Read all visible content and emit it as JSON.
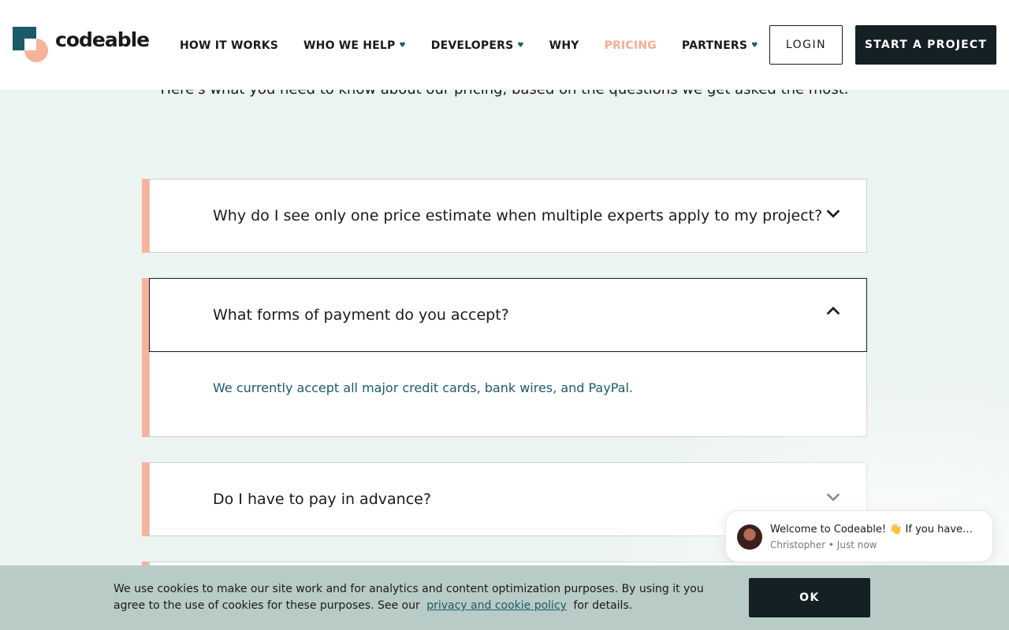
{
  "header": {
    "logo_text": "codeable",
    "nav": [
      {
        "label": "HOW IT WORKS",
        "has_dropdown": false,
        "active": false
      },
      {
        "label": "WHO WE HELP",
        "has_dropdown": true,
        "active": false
      },
      {
        "label": "DEVELOPERS",
        "has_dropdown": true,
        "active": false
      },
      {
        "label": "WHY",
        "has_dropdown": false,
        "active": false
      },
      {
        "label": "PRICING",
        "has_dropdown": false,
        "active": true
      },
      {
        "label": "PARTNERS",
        "has_dropdown": true,
        "active": false
      }
    ],
    "login_label": "LOGIN",
    "start_label": "START A PROJECT"
  },
  "intro": "Here's what you need to know about our pricing, based on the questions we get asked the most.",
  "faq": [
    {
      "question": "Why do I see only one price estimate when multiple experts apply to my project?",
      "expanded": false
    },
    {
      "question": "What forms of payment do you accept?",
      "expanded": true,
      "answer": "We currently accept all major credit cards, bank wires, and PayPal."
    },
    {
      "question": "Do I have to pay in advance?",
      "expanded": false
    }
  ],
  "chat": {
    "message": "Welcome to Codeable! 👋 If you have any questions, just ask!",
    "meta": "Christopher • Just now"
  },
  "cookie": {
    "text_before": "We use cookies to make our site work and for analytics and content optimization purposes. By using it you agree to the use of cookies for these purposes. See our",
    "link": "privacy and cookie policy",
    "text_after": "for details.",
    "ok_label": "OK"
  },
  "colors": {
    "brand_dark": "#1b5a6b",
    "brand_peach": "#f7b29c",
    "button_dark": "#142024",
    "page_bg": "#ecf4f1",
    "cookie_bg": "#b9cbc6"
  }
}
